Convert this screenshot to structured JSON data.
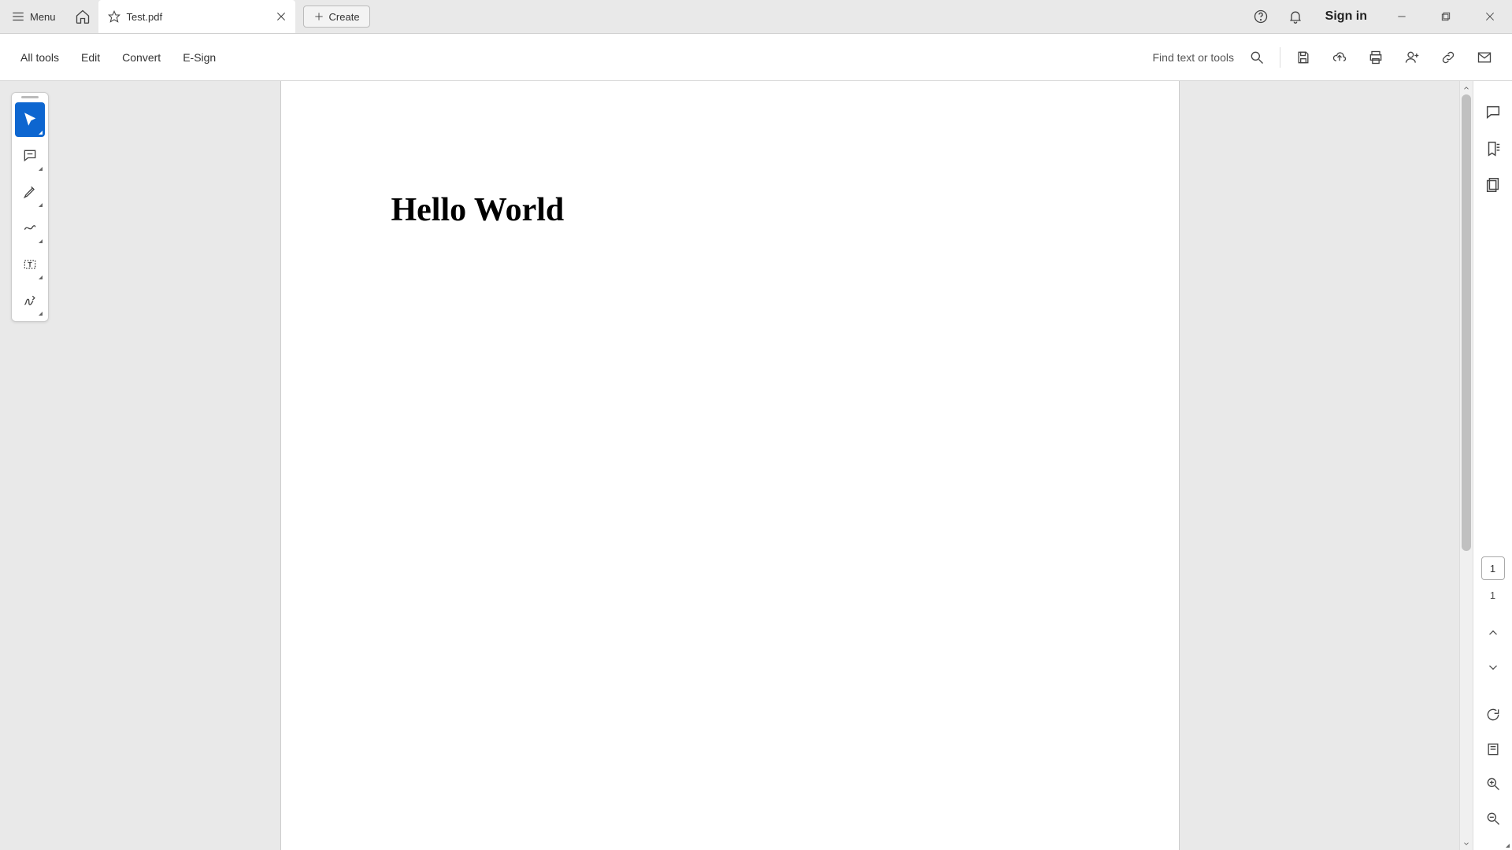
{
  "titlebar": {
    "menu_label": "Menu",
    "tab_title": "Test.pdf",
    "create_label": "Create",
    "signin_label": "Sign in"
  },
  "toolbar": {
    "all_tools": "All tools",
    "edit": "Edit",
    "convert": "Convert",
    "esign": "E-Sign",
    "find_placeholder": "Find text or tools"
  },
  "document": {
    "heading": "Hello World"
  },
  "pager": {
    "current": "1",
    "total": "1"
  }
}
